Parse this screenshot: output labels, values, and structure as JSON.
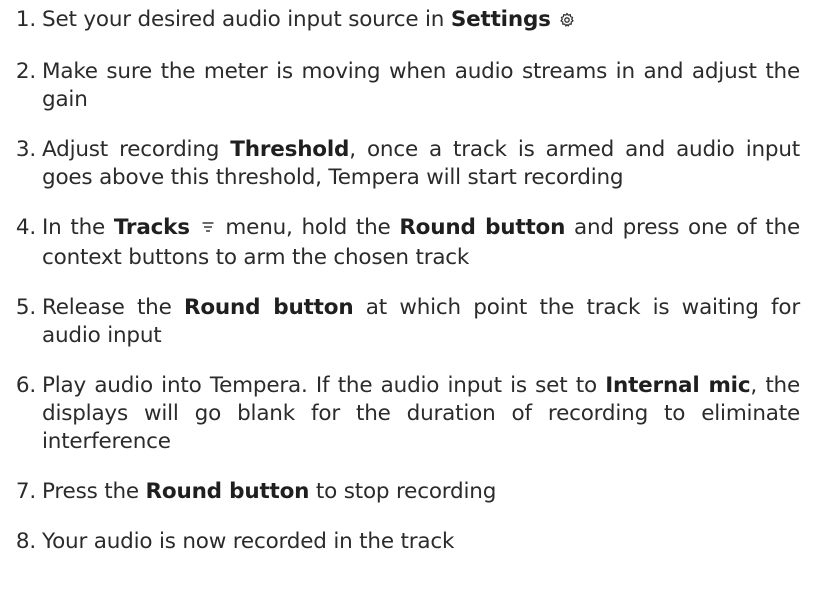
{
  "steps": [
    {
      "number": "1.",
      "parts": [
        {
          "text": "Set your desired audio input source in "
        },
        {
          "text": "Settings",
          "bold": true
        },
        {
          "text": " "
        },
        {
          "icon": "gear-icon"
        }
      ]
    },
    {
      "number": "2.",
      "parts": [
        {
          "text": "Make sure the meter is moving when audio streams in and adjust the gain"
        }
      ]
    },
    {
      "number": "3.",
      "parts": [
        {
          "text": "Adjust recording "
        },
        {
          "text": "Threshold",
          "bold": true
        },
        {
          "text": ", once a track is armed and audio input goes above this threshold, Tempera will start recording"
        }
      ]
    },
    {
      "number": "4.",
      "parts": [
        {
          "text": "In the "
        },
        {
          "text": "Tracks",
          "bold": true
        },
        {
          "text": " "
        },
        {
          "icon": "tracks-menu-icon"
        },
        {
          "text": " menu, hold the "
        },
        {
          "text": "Round button",
          "bold": true
        },
        {
          "text": " and press one of the context buttons to arm the chosen track"
        }
      ]
    },
    {
      "number": "5.",
      "parts": [
        {
          "text": "Release the "
        },
        {
          "text": "Round button",
          "bold": true
        },
        {
          "text": " at which point the track is wait­aiting for audio input"
        }
      ]
    },
    {
      "number": "6.",
      "parts": [
        {
          "text": "Play audio into Tempera.  If the audio input is set to "
        },
        {
          "text": "In­ternal mic",
          "bold": true
        },
        {
          "text": ", the displays will go blank for the duration of recording to eliminate interference"
        }
      ]
    },
    {
      "number": "7.",
      "parts": [
        {
          "text": "Press the "
        },
        {
          "text": "Round button",
          "bold": true
        },
        {
          "text": " to stop recording"
        }
      ]
    },
    {
      "number": "8.",
      "parts": [
        {
          "text": "Your audio is now recorded in the track"
        }
      ]
    }
  ]
}
